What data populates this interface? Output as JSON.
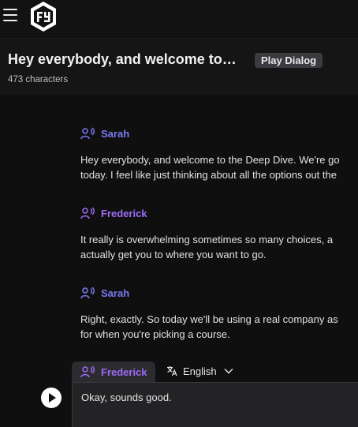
{
  "header": {
    "title": "Hey everybody, and welcome to…",
    "play_dialog_label": "Play Dialog",
    "char_count": "473 characters"
  },
  "dialog": [
    {
      "speaker": "Sarah",
      "line1": "Hey everybody, and welcome to the Deep Dive. We're go",
      "line2": "today. I feel like just thinking about all the options out the"
    },
    {
      "speaker": "Frederick",
      "line1": "It really is overwhelming sometimes so many choices, a",
      "line2": "actually get you to where you want to go."
    },
    {
      "speaker": "Sarah",
      "line1": "Right, exactly. So today we'll be using a real company as",
      "line2": "for when you're picking a course."
    }
  ],
  "editor": {
    "speaker": "Frederick",
    "language": "English",
    "text": "Okay, sounds good."
  },
  "icons": {
    "menu": "hamburger-icon",
    "logo": "logo-icon",
    "speaker": "speaker-voice-icon",
    "language": "translate-icon",
    "chevron": "chevron-down-icon",
    "play": "play-icon"
  },
  "colors": {
    "sarah": "#7b7bf2",
    "frederick": "#9c6cf5",
    "background": "#0f0f10"
  }
}
